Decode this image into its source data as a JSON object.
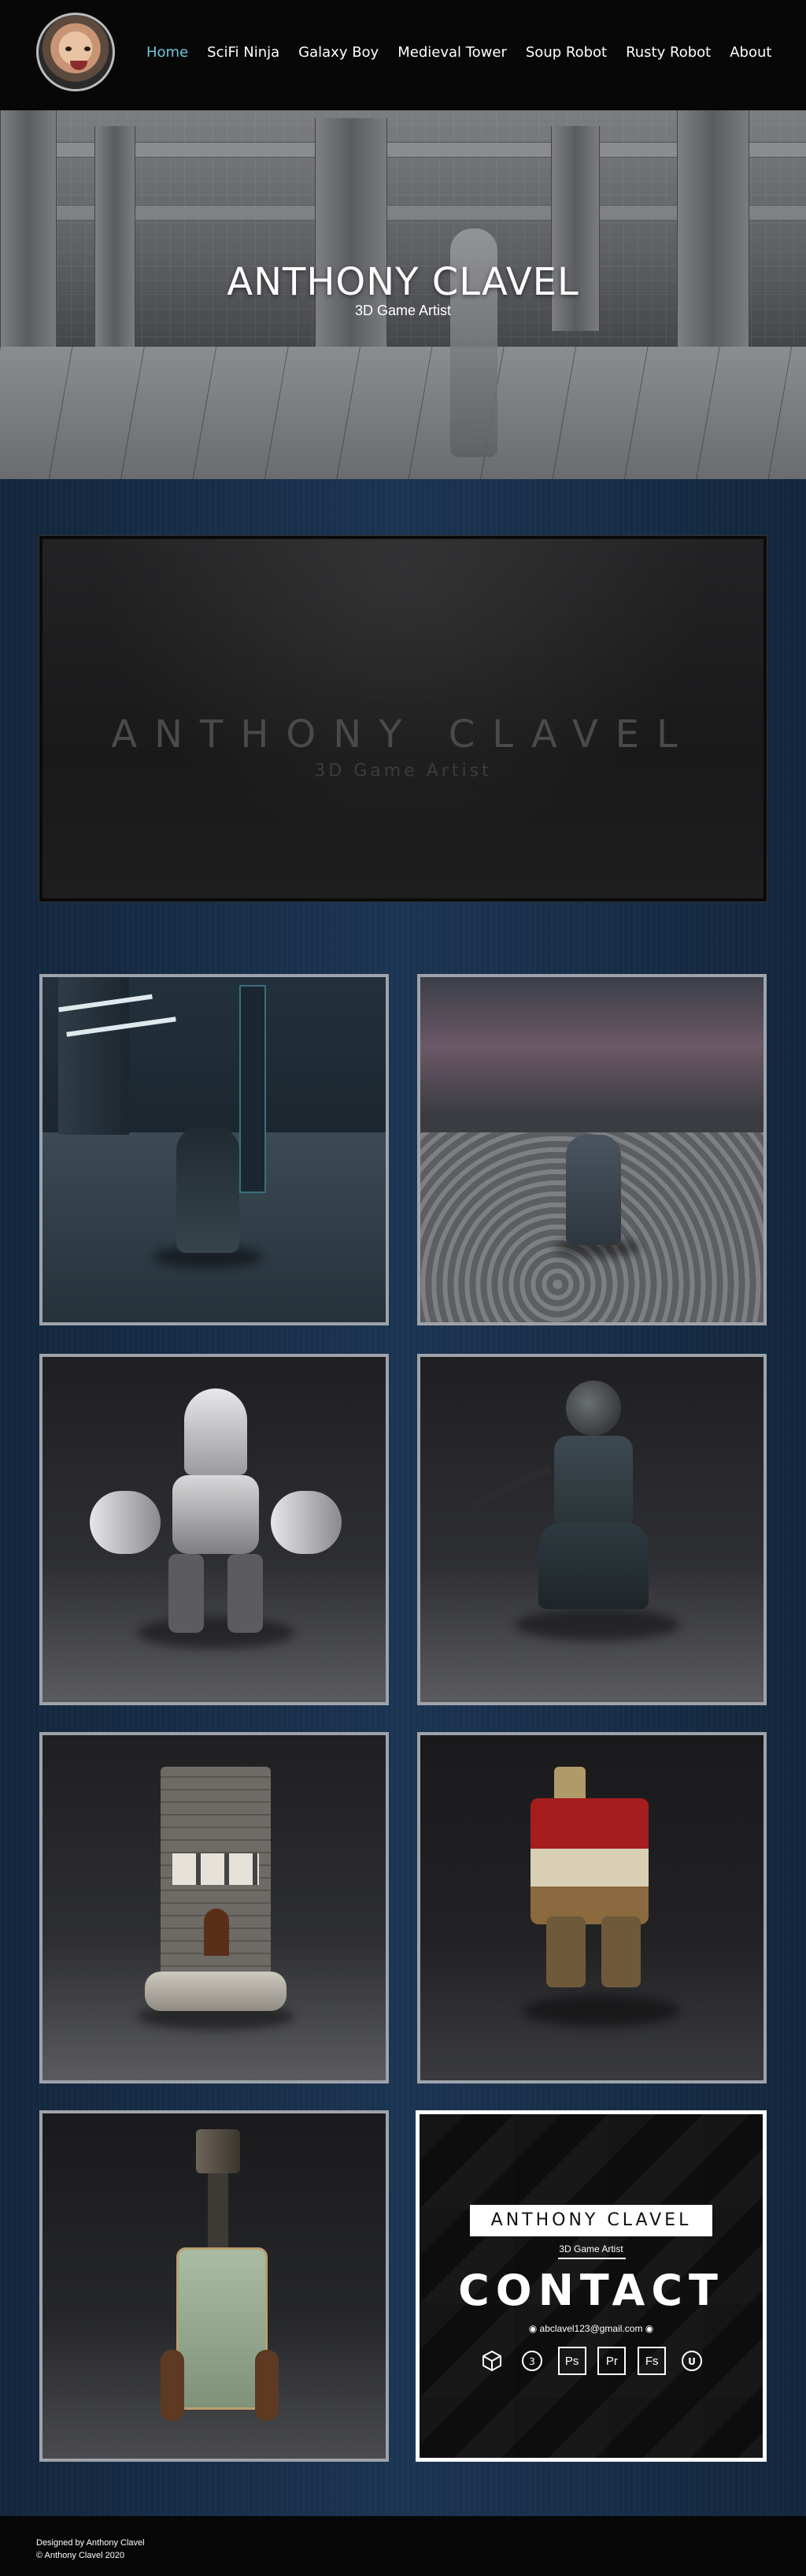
{
  "nav": {
    "items": [
      {
        "label": "Home",
        "active": true
      },
      {
        "label": "SciFi Ninja"
      },
      {
        "label": "Galaxy Boy"
      },
      {
        "label": "Medieval Tower"
      },
      {
        "label": "Soup Robot"
      },
      {
        "label": "Rusty Robot"
      },
      {
        "label": "About"
      }
    ],
    "active_color": "#6ec7d8"
  },
  "hero": {
    "title": "ANTHONY CLAVEL",
    "subtitle": "3D Game Artist"
  },
  "video": {
    "title": "ANTHONY CLAVEL",
    "subtitle": "3D Game Artist"
  },
  "gallery": {
    "tiles": [
      {
        "icon": "scifi-ninja-corridor-image"
      },
      {
        "icon": "galaxy-boy-moon-image"
      },
      {
        "icon": "galaxy-boy-robot-image"
      },
      {
        "icon": "scifi-ninja-render-image"
      },
      {
        "icon": "medieval-tower-image"
      },
      {
        "icon": "soup-robot-image"
      },
      {
        "icon": "rusty-robot-image"
      }
    ]
  },
  "contact": {
    "name": "ANTHONY CLAVEL",
    "role": "3D Game Artist",
    "heading": "CONTACT",
    "email": "abclavel123@gmail.com",
    "software": [
      {
        "icon": "unity-icon",
        "label": ""
      },
      {
        "icon": "3dsmax-icon",
        "label": ""
      },
      {
        "icon": "photoshop-icon",
        "label": "Ps"
      },
      {
        "icon": "premiere-icon",
        "label": "Pr"
      },
      {
        "icon": "fuse-icon",
        "label": "Fs"
      },
      {
        "icon": "unreal-icon",
        "label": ""
      }
    ]
  },
  "footer": {
    "line1": "Designed by Anthony Clavel",
    "line2": "© Anthony Clavel 2020"
  }
}
